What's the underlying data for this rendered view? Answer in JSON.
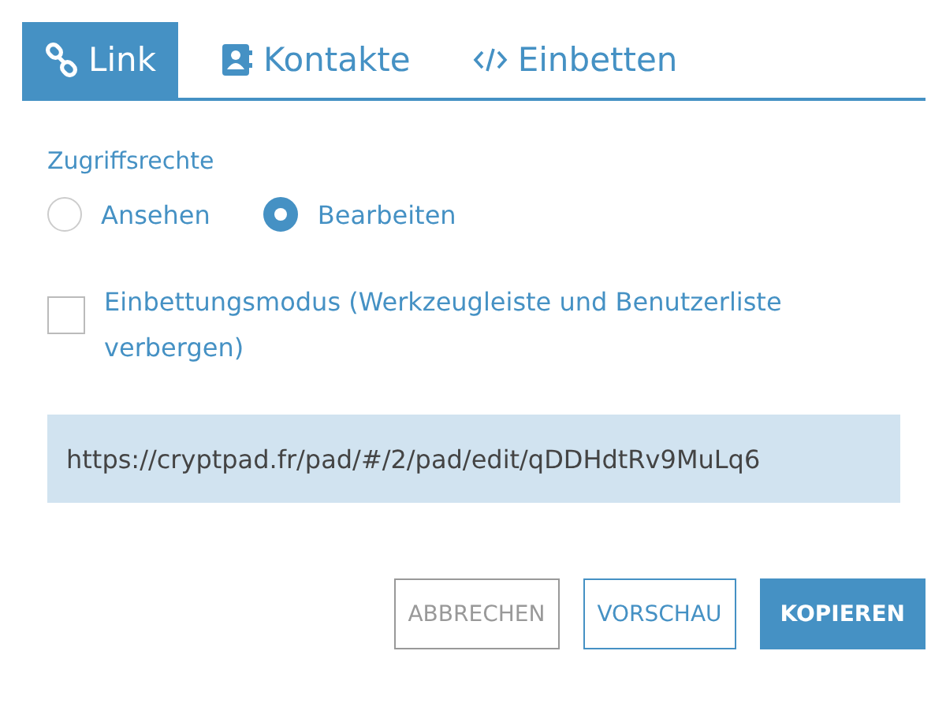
{
  "tabs": [
    {
      "label": "Link",
      "kind": "link",
      "selected": true
    },
    {
      "label": "Kontakte",
      "kind": "contacts",
      "selected": false
    },
    {
      "label": "Einbetten",
      "kind": "code",
      "selected": false
    }
  ],
  "access": {
    "label": "Zugriffsrechte",
    "options": [
      {
        "label": "Ansehen",
        "selected": false
      },
      {
        "label": "Bearbeiten",
        "selected": true
      }
    ]
  },
  "embed_mode": {
    "label": "Einbettungsmodus (Werkzeugleiste und Benutzerliste verbergen)",
    "checked": false
  },
  "link_field": {
    "value": "https://cryptpad.fr/pad/#/2/pad/edit/qDDHdtRv9MuLq6"
  },
  "buttons": [
    {
      "label": "ABBRECHEN",
      "kind": "cancel"
    },
    {
      "label": "VORSCHAU",
      "kind": "outline"
    },
    {
      "label": "KOPIEREN",
      "kind": "primary"
    }
  ]
}
